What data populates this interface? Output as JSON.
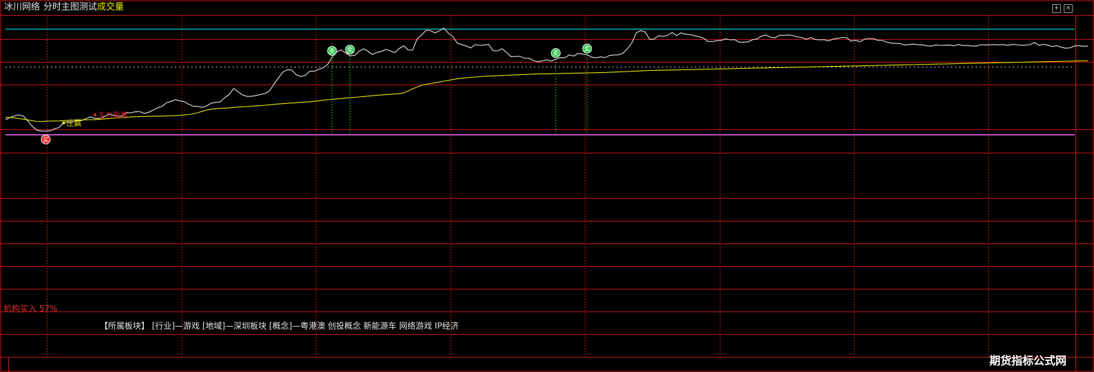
{
  "header": {
    "stock_name": "冰川网络",
    "mode": "分时",
    "test_label": "主图测试",
    "volume_label": "成交量"
  },
  "footer": {
    "block_line": "【所属板块】 [行业]—游戏 [地域]—深圳板块 [概念]—粤港澳 创投概念 新能源车 网络游戏 IP经济",
    "institution_buy": "机构买入 57%",
    "watermark": "期货指标公式网"
  },
  "colors": {
    "background": "#000000",
    "grid": "#c81414",
    "price_line": "#e6e6e6",
    "avg_line": "#e6e600",
    "high_line": "#00c8c8",
    "low_line": "#c050c0",
    "buy_marker": "#e02020",
    "sell_marker": "#20c040",
    "annotation_red": "#e02020",
    "annotation_yellow": "#e6e600"
  },
  "icons": [
    "expand-icon",
    "close-icon"
  ],
  "chart_data": {
    "type": "line",
    "x_count": 240,
    "ylim": [
      0,
      100
    ],
    "grid": true,
    "series": [
      {
        "key": "price",
        "values": [
          66.0,
          68.4,
          69.9,
          70.9,
          69.7,
          64.9,
          59.5,
          55.7,
          54.9,
          54.6,
          55.1,
          57.2,
          58.3,
          63.3,
          63.9,
          64.1,
          65.2,
          65.3,
          67.2,
          69.0,
          67.4,
          67.4,
          69.2,
          71.5,
          70.8,
          69.7,
          69.8,
          73.2,
          73.1,
          74.1,
          74.2,
          72.5,
          73.6,
          75.8,
          78.1,
          79.6,
          83.1,
          84.6,
          86.2,
          85.0,
          84.2,
          81.5,
          79.6,
          79.5,
          78.4,
          80.0,
          82.8,
          83.5,
          84.1,
          88.3,
          91.4,
          97.5,
          94.2,
          91.0,
          89.5,
          89.6,
          90.4,
          91.5,
          92.5,
          95.0,
          101.8,
          107.9,
          113.9,
          116.3,
          116.0,
          111.2,
          109.5,
          110.4,
          114.8,
          114.7,
          116.6,
          118.2,
          121.5,
          129.0,
          133.9,
          136.2,
          133.2,
          130.3,
          130.6,
          134.6,
          137.3,
          134.8,
          131.6,
          133.6,
          134.6,
          136.6,
          135.2,
          133.4,
          137.6,
          140.3,
          136.1,
          136.0,
          147.2,
          151.1,
          155.8,
          155.5,
          153.2,
          155.3,
          158.1,
          152.8,
          149.5,
          142.9,
          141.5,
          140.1,
          138.1,
          141.6,
          140.7,
          141.1,
          141.7,
          135.4,
          135.2,
          137.4,
          133.5,
          129.4,
          129.5,
          129.7,
          127.9,
          127.8,
          125.6,
          124.2,
          125.1,
          126.2,
          125.0,
          126.8,
          128.4,
          128.2,
          131.1,
          130.0,
          132.7,
          131.9,
          131.3,
          128.9,
          128.2,
          129.2,
          128.5,
          130.5,
          131.1,
          131.2,
          132.7,
          137.3,
          143.2,
          153.4,
          155.5,
          154.0,
          146.7,
          147.0,
          150.5,
          149.6,
          150.8,
          153.6,
          150.5,
          153.3,
          151.9,
          151.4,
          150.5,
          149.4,
          147.9,
          144.7,
          144.5,
          145.4,
          145.7,
          147.2,
          146.2,
          146.5,
          143.9,
          143.9,
          144.2,
          146.4,
          147.2,
          150.1,
          151.2,
          148.8,
          148.3,
          150.9,
          150.7,
          151.1,
          150.7,
          149.1,
          148.6,
          146.8,
          148.5,
          146.6,
          146.3,
          146.4,
          145.1,
          147.1,
          147.7,
          148.6,
          148.4,
          145.0,
          145.7,
          144.4,
          146.8,
          147.6,
          147.4,
          145.7,
          145.5,
          144.1,
          142.9,
          142.7,
          142.4,
          141.1,
          141.5,
          141.9,
          141.3,
          141.2,
          140.2,
          140.0,
          141.2,
          140.7,
          140.9,
          141.0,
          140.3,
          141.6,
          140.5,
          140.6,
          140.1,
          140.1,
          141.4,
          141.1,
          141.3,
          141.6,
          141.2,
          141.5,
          140.8,
          141.6,
          141.4,
          140.8,
          141.0,
          141.4,
          143.5,
          140.8,
          141.8,
          140.9,
          139.5,
          140.4,
          138.8,
          137.8,
          138.3,
          140.2,
          140.2,
          139.8,
          139.9
        ]
      },
      {
        "key": "avg",
        "values": [
          68.5,
          68.4,
          68.0,
          67.3,
          66.7,
          65.9,
          65.1,
          64.5,
          64.3,
          64.6,
          64.8,
          64.9,
          65.0,
          65.3,
          65.4,
          65.6,
          65.8,
          65.9,
          66.0,
          66.2,
          66.3,
          66.5,
          66.8,
          67.2,
          67.6,
          68.0,
          68.3,
          68.6,
          68.9,
          69.1,
          69.3,
          69.4,
          69.5,
          69.6,
          69.7,
          69.8,
          69.9,
          70.0,
          70.2,
          70.5,
          70.9,
          71.4,
          72.1,
          73.2,
          74.6,
          75.9,
          76.7,
          77.2,
          77.5,
          77.8,
          78.0,
          78.4,
          78.8,
          79.1,
          79.3,
          79.6,
          79.9,
          80.3,
          80.7,
          81.1,
          81.5,
          81.9,
          82.3,
          82.6,
          82.9,
          83.2,
          83.6,
          83.9,
          84.2,
          84.6,
          85.1,
          85.7,
          86.2,
          86.6,
          87.0,
          87.4,
          87.8,
          88.2,
          88.6,
          89.0,
          89.4,
          89.8,
          90.2,
          90.6,
          91.0,
          91.3,
          91.6,
          91.9,
          92.3,
          93.0,
          95.0,
          97.0,
          99.0,
          100.6,
          101.5,
          102.4,
          103.2,
          104.0,
          104.8,
          105.6,
          106.4,
          107.2,
          107.8,
          108.2,
          108.6,
          109.0,
          109.3,
          109.6,
          109.9,
          110.1,
          110.3,
          110.5,
          110.7,
          110.9,
          111.1,
          111.3,
          111.5,
          111.7,
          111.9,
          112.0,
          112.1,
          112.2,
          112.3,
          112.4,
          112.5,
          112.6,
          112.7,
          112.8,
          112.9,
          113.0,
          113.1,
          113.2,
          113.3,
          113.4,
          113.5,
          113.7,
          113.9,
          114.1,
          114.3,
          114.5,
          114.7,
          114.9,
          115.1,
          115.3,
          115.5,
          115.6,
          115.7,
          115.8,
          115.9,
          116.0,
          116.1,
          116.2,
          116.3,
          116.4,
          116.5,
          116.6,
          116.7,
          116.8,
          116.9,
          117.0,
          117.1,
          117.2,
          117.3,
          117.4,
          117.5,
          117.6,
          117.7,
          117.8,
          117.9,
          118.0,
          118.1,
          118.2,
          118.3,
          118.4,
          118.5,
          118.6,
          118.7,
          118.8,
          118.9,
          119.0,
          119.1,
          119.2,
          119.3,
          119.4,
          119.5,
          119.6,
          119.7,
          119.8,
          119.9,
          120.0,
          120.1,
          120.2,
          120.3,
          120.4,
          120.5,
          120.6,
          120.7,
          120.8,
          120.9,
          121.0,
          121.1,
          121.2,
          121.3,
          121.4,
          121.5,
          121.6,
          121.7,
          121.8,
          121.9,
          122.0,
          122.1,
          122.2,
          122.3,
          122.4,
          122.5,
          122.6,
          122.7,
          122.8,
          122.9,
          123.0,
          123.1,
          123.2,
          123.3,
          123.4,
          123.5,
          123.6,
          123.7,
          123.8,
          123.9,
          124.0,
          124.1,
          124.2,
          124.3,
          124.4,
          124.5,
          124.6,
          124.7,
          124.8,
          124.9,
          125.0,
          125.1,
          125.2,
          125.3
        ]
      }
    ],
    "high_level": 157.0,
    "low_level": 51.0,
    "prev_close": 119.0,
    "signals": [
      {
        "index": 9,
        "type": "buy",
        "label": "买"
      },
      {
        "index": 73,
        "type": "sell",
        "label": "卖"
      },
      {
        "index": 77,
        "type": "sell",
        "label": "卖"
      },
      {
        "index": 123,
        "type": "sell",
        "label": "卖"
      },
      {
        "index": 130,
        "type": "sell",
        "label": "卖"
      }
    ],
    "annotations": [
      {
        "index": 20,
        "value": 71,
        "text": "主力吸筹",
        "color": "red"
      },
      {
        "index": 13,
        "value": 63,
        "text": "庄赢",
        "color": "yellow"
      }
    ]
  }
}
